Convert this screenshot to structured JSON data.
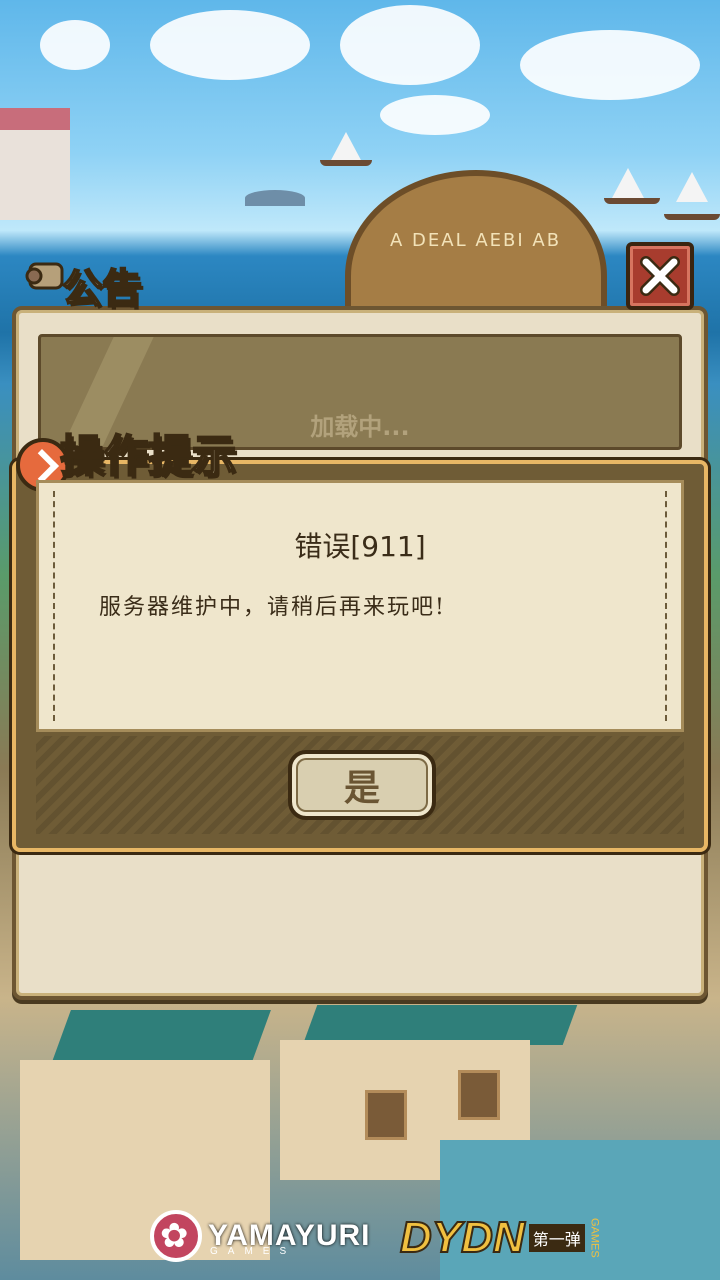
{
  "notice": {
    "title": "公告",
    "loading_text": "加载中...",
    "gear_text": "A DEAL AEBI AB"
  },
  "dialog": {
    "header": "操作提示",
    "error_title": "错误[911]",
    "message": "服务器维护中，请稍后再来玩吧!",
    "yes_label": "是"
  },
  "logos": {
    "yamayuri": "YAMAYURI",
    "yamayuri_sub": "GAMES",
    "dydn": "DYDN",
    "dydn_sub": "第一弹",
    "dydn_games": "GAMES"
  },
  "icons": {
    "close": "close-icon",
    "scroll": "scroll-icon",
    "badge": "arrow-badge-icon"
  },
  "colors": {
    "close_button": "#a83c2e",
    "panel": "#e9dfc8",
    "dialog_border": "#e8b765"
  }
}
